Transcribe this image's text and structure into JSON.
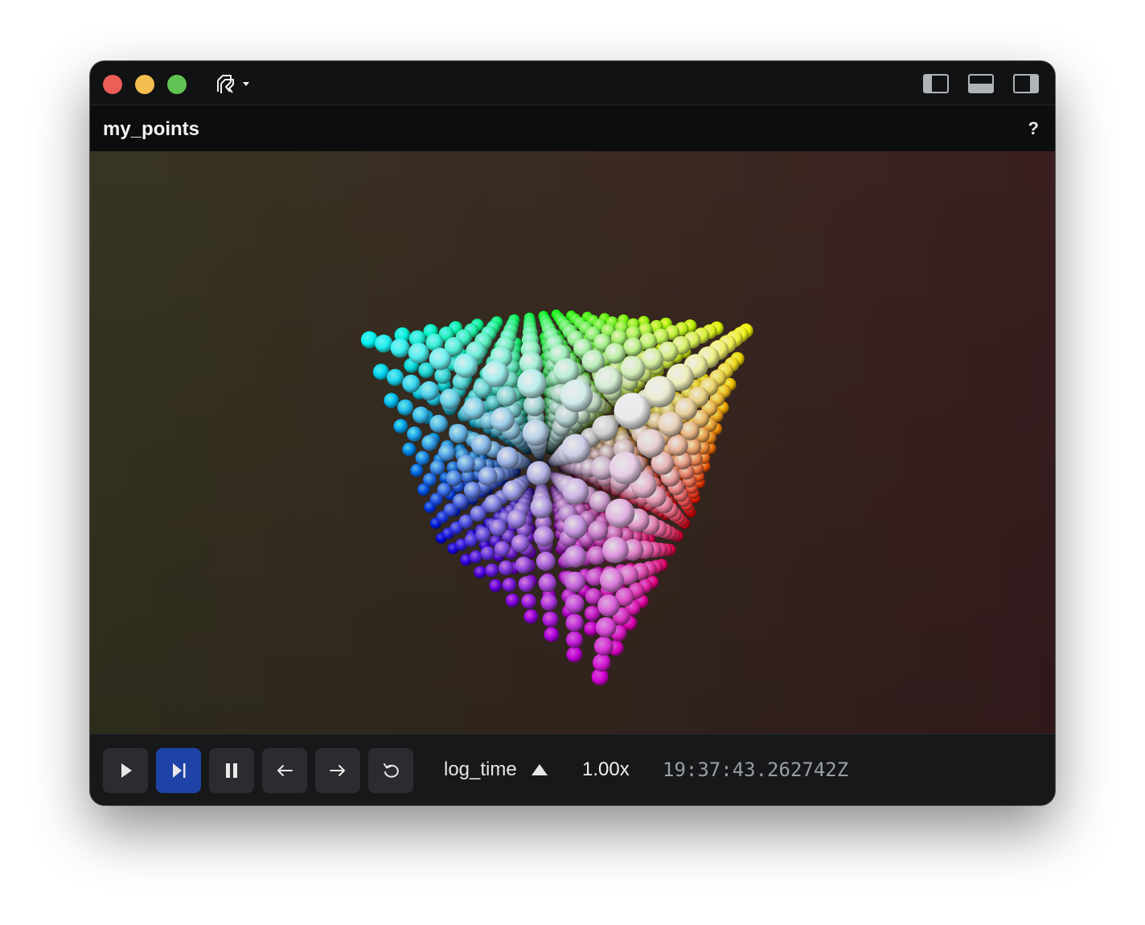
{
  "window": {
    "traffic_lights": {
      "close": "#ed5e57",
      "minimize": "#f4bd4f",
      "zoom": "#60c454"
    },
    "app_logo": "rerun-logo-icon"
  },
  "view": {
    "title": "my_points",
    "help_label": "?"
  },
  "viewport": {
    "content": "3d-point-cloud-cube"
  },
  "time_panel": {
    "buttons": [
      {
        "name": "play-button",
        "icon": "play-icon"
      },
      {
        "name": "follow-button",
        "icon": "skip-to-end-icon",
        "active": true
      },
      {
        "name": "pause-button",
        "icon": "pause-icon"
      },
      {
        "name": "step-back-button",
        "icon": "arrow-left-icon"
      },
      {
        "name": "step-forward-button",
        "icon": "arrow-right-icon"
      },
      {
        "name": "loop-button",
        "icon": "loop-icon"
      }
    ],
    "timeline": "log_time",
    "speed": "1.00x",
    "current_time": "19:37:43.262742Z",
    "accent_color": "#1d43a6"
  }
}
